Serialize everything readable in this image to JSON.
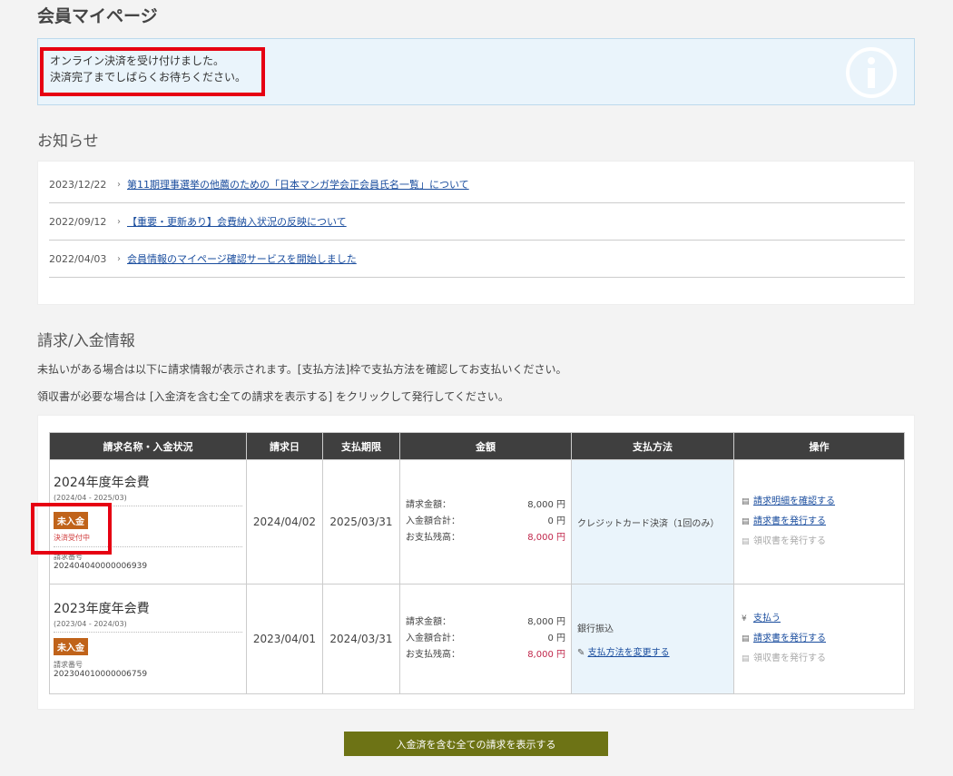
{
  "page": {
    "title": "会員マイページ"
  },
  "notice": {
    "line1": "オンライン決済を受け付けました。",
    "line2": "決済完了までしばらくお待ちください。",
    "icon": "info-icon"
  },
  "news": {
    "title": "お知らせ",
    "items": [
      {
        "date": "2023/12/22",
        "text": "第11期理事選挙の他薦のための「日本マンガ学会正会員氏名一覧」について"
      },
      {
        "date": "2022/09/12",
        "text": "【重要・更新あり】会費納入状況の反映について"
      },
      {
        "date": "2022/04/03",
        "text": "会員情報のマイページ確認サービスを開始しました"
      }
    ]
  },
  "billing": {
    "title": "請求/入金情報",
    "desc1": "未払いがある場合は以下に請求情報が表示されます。[支払方法]枠で支払方法を確認してお支払いください。",
    "desc2": "領収書が必要な場合は [入金済を含む全ての請求を表示する] をクリックして発行してください。",
    "headers": {
      "name": "請求名称・入金状況",
      "date": "請求日",
      "due": "支払期限",
      "amount": "金額",
      "method": "支払方法",
      "ops": "操作"
    },
    "rows": [
      {
        "name": "2024年度年会費",
        "period": "(2024/04 - 2025/03)",
        "status": "未入金",
        "status_sub": "決済受付中",
        "billno_label": "請求番号",
        "billno": "202404040000006939",
        "date": "2024/04/02",
        "due": "2025/03/31",
        "amt_label1": "請求金額：",
        "amt1": "8,000 円",
        "amt_label2": "入金額合計：",
        "amt2": "0 円",
        "amt_label3": "お支払残高：",
        "amt3": "8,000 円",
        "method": "クレジットカード決済（1回のみ）",
        "op1": "請求明細を確認する",
        "op2": "請求書を発行する",
        "op3": "領収書を発行する"
      },
      {
        "name": "2023年度年会費",
        "period": "(2023/04 - 2024/03)",
        "status": "未入金",
        "billno_label": "請求番号",
        "billno": "202304010000006759",
        "date": "2023/04/01",
        "due": "2024/03/31",
        "amt_label1": "請求金額：",
        "amt1": "8,000 円",
        "amt_label2": "入金額合計：",
        "amt2": "0 円",
        "amt_label3": "お支払残高：",
        "amt3": "8,000 円",
        "method": "銀行振込",
        "method_link": "支払方法を変更する",
        "op1": "支払う",
        "op2": "請求書を発行する",
        "op3": "領収書を発行する"
      }
    ]
  },
  "show_all_button": "入金済を含む全ての請求を表示する",
  "colors": {
    "highlight": "#e60012",
    "badge": "#c0631a",
    "button": "#6d7315",
    "header": "#3f3f3f",
    "link": "#1a4d9e"
  }
}
